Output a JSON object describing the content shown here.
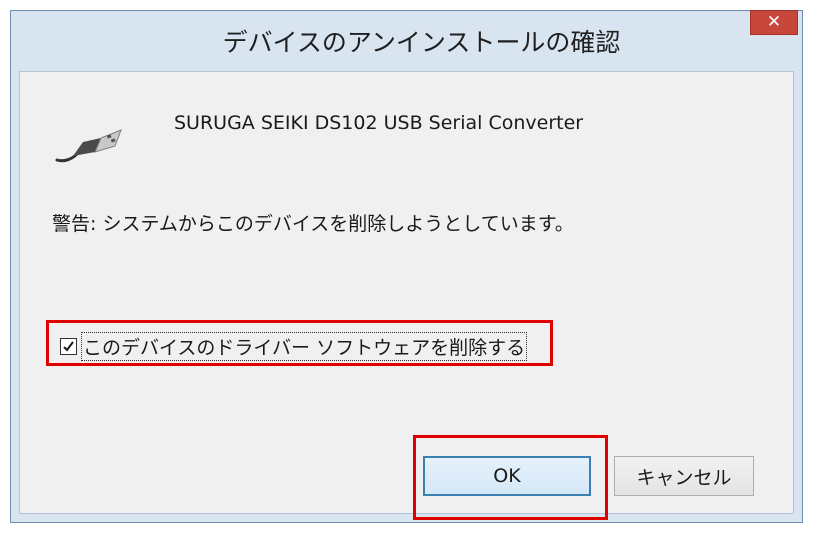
{
  "window": {
    "title": "デバイスのアンインストールの確認",
    "close_icon": "close-icon",
    "close_glyph": "✕"
  },
  "device": {
    "icon": "usb-plug-icon",
    "name": "SURUGA SEIKI DS102 USB Serial Converter"
  },
  "warning": {
    "text": "警告: システムからこのデバイスを削除しようとしています。"
  },
  "delete_driver": {
    "label": "このデバイスのドライバー ソフトウェアを削除する",
    "checked": true
  },
  "buttons": {
    "ok_label": "OK",
    "cancel_label": "キャンセル"
  },
  "colors": {
    "highlight": "#e00000",
    "close_button": "#c7473a",
    "frame": "#d9e4f1"
  }
}
